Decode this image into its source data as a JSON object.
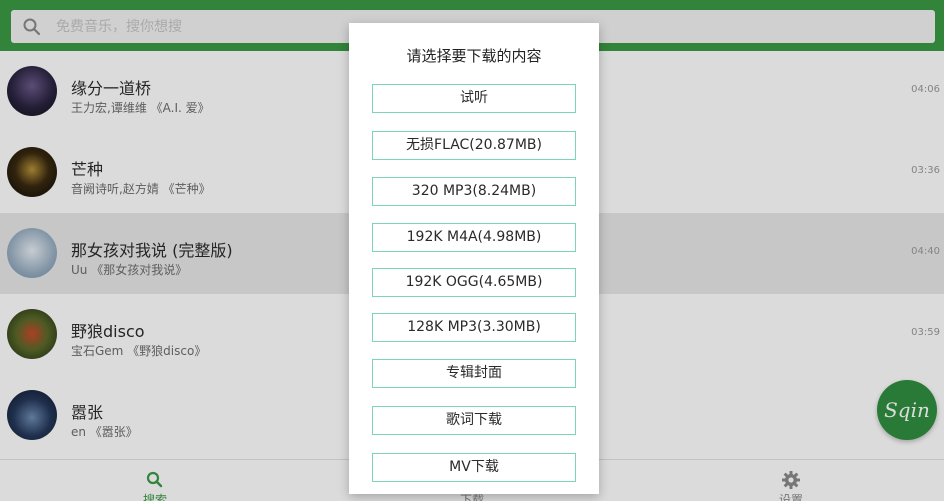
{
  "search": {
    "placeholder": "免费音乐，搜你想搜"
  },
  "songs": [
    {
      "title": "缘分一道桥",
      "subtitle": "王力宏,谭维维 《A.I. 爱》",
      "duration": "04:06"
    },
    {
      "title": "芒种",
      "subtitle": "音阙诗听,赵方婧 《芒种》",
      "duration": "03:36"
    },
    {
      "title": "那女孩对我说 (完整版)",
      "subtitle": "Uu 《那女孩对我说》",
      "duration": "04:40"
    },
    {
      "title": "野狼disco",
      "subtitle": "宝石Gem 《野狼disco》",
      "duration": "03:59"
    },
    {
      "title": "嚣张",
      "subtitle": "en 《嚣张》",
      "duration": ""
    }
  ],
  "nav": {
    "search_label": "搜索",
    "download_label": "下载",
    "settings_label": "设置"
  },
  "fab": {
    "label": "Sqin"
  },
  "dialog": {
    "title": "请选择要下载的内容",
    "options": [
      "试听",
      "无损FLAC(20.87MB)",
      "320 MP3(8.24MB)",
      "192K M4A(4.98MB)",
      "192K OGG(4.65MB)",
      "128K MP3(3.30MB)",
      "专辑封面",
      "歌词下载",
      "MV下载"
    ]
  },
  "colors": {
    "header": "#3a9a44",
    "accent": "#3a9a44",
    "option_border": "#7fd3b8",
    "fab": "#2f8f3f"
  }
}
